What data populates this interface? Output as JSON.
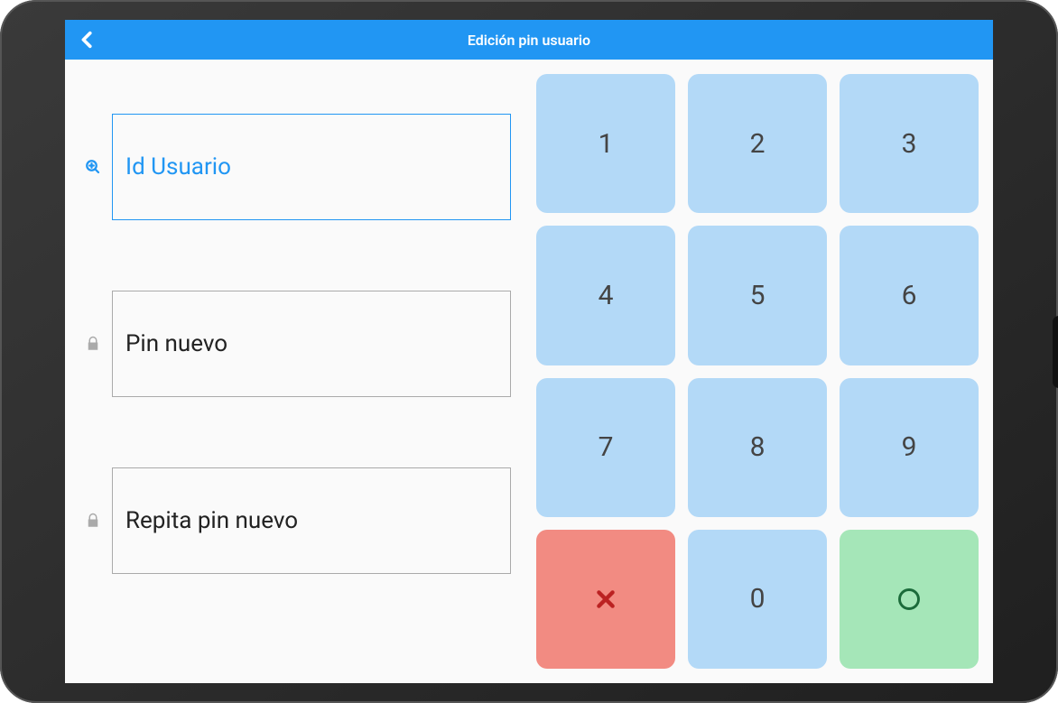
{
  "header": {
    "title": "Edición pin usuario"
  },
  "form": {
    "user_id": {
      "placeholder": "Id Usuario",
      "value": "",
      "active": true
    },
    "new_pin": {
      "placeholder": "Pin nuevo",
      "value": ""
    },
    "repeat_pin": {
      "placeholder": "Repita pin nuevo",
      "value": ""
    }
  },
  "keypad": {
    "k1": "1",
    "k2": "2",
    "k3": "3",
    "k4": "4",
    "k5": "5",
    "k6": "6",
    "k7": "7",
    "k8": "8",
    "k9": "9",
    "k0": "0"
  },
  "colors": {
    "accent": "#2196f3",
    "key_bg": "#b3d9f7",
    "cancel_bg": "#f28b82",
    "confirm_bg": "#a5e6b8"
  }
}
